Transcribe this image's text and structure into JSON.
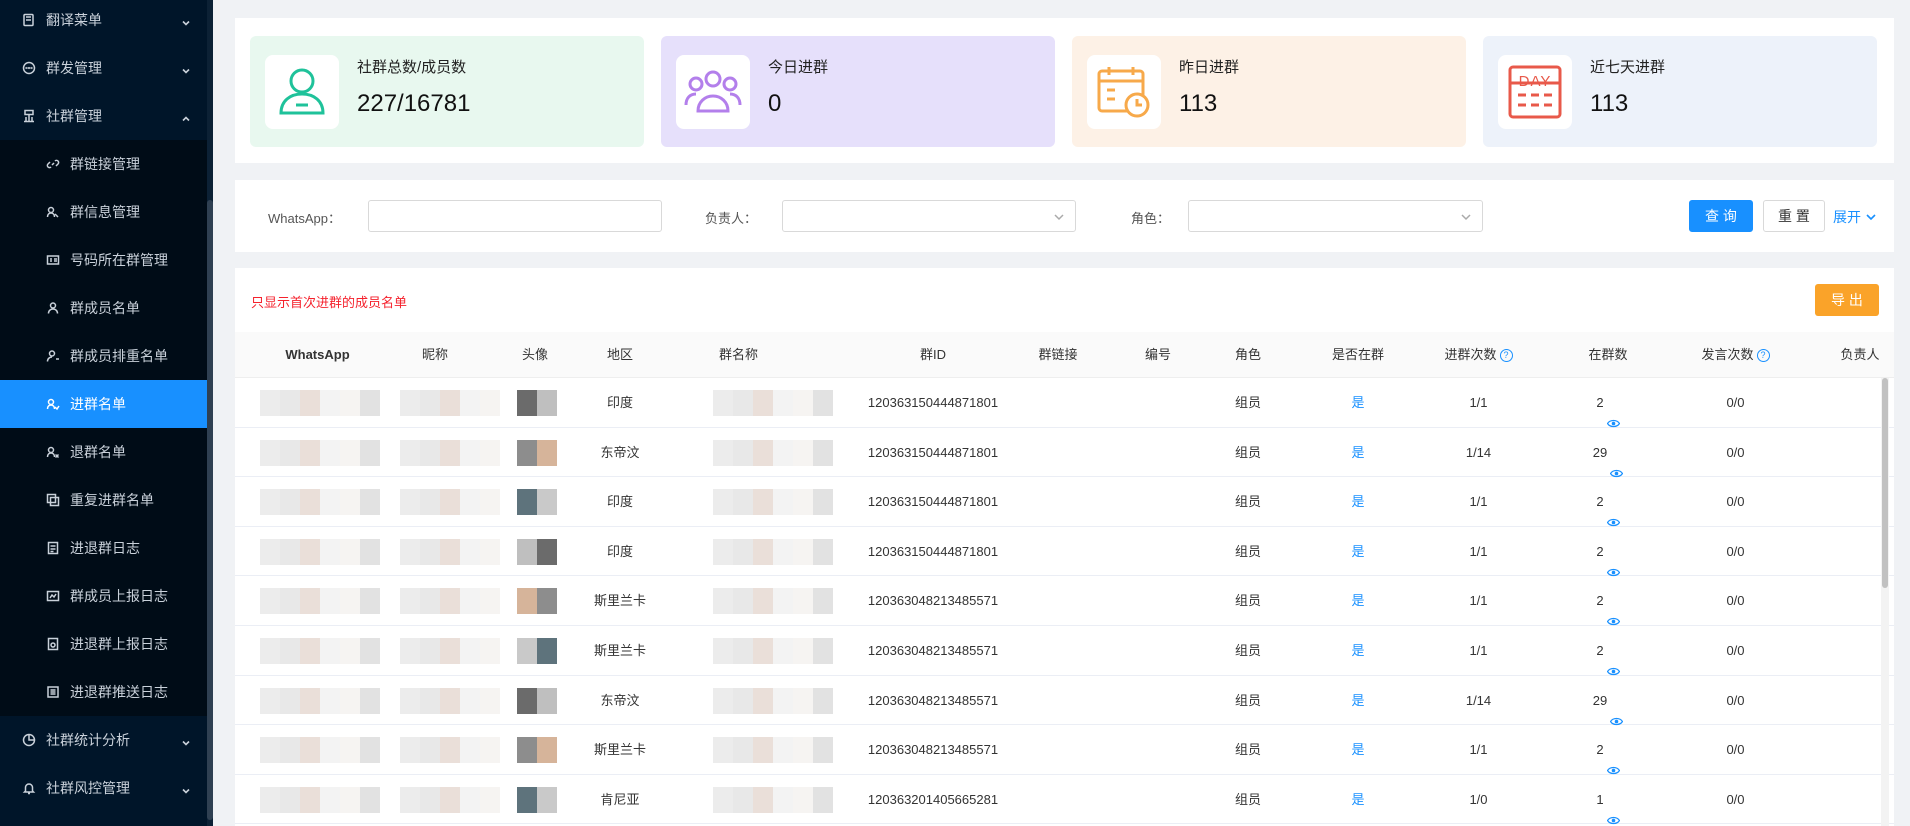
{
  "sidebar": {
    "items": [
      {
        "label": "翻译菜单",
        "level": "top",
        "icon": "translate-icon",
        "chevron": "down"
      },
      {
        "label": "群发管理",
        "level": "top",
        "icon": "chat-icon",
        "chevron": "down"
      },
      {
        "label": "社群管理",
        "level": "top",
        "icon": "community-icon",
        "chevron": "up"
      },
      {
        "label": "群链接管理",
        "level": "sub",
        "icon": "link-icon"
      },
      {
        "label": "群信息管理",
        "level": "sub",
        "icon": "group-info-icon"
      },
      {
        "label": "号码所在群管理",
        "level": "sub",
        "icon": "id-card-icon"
      },
      {
        "label": "群成员名单",
        "level": "sub",
        "icon": "user-icon"
      },
      {
        "label": "群成员排重名单",
        "level": "sub",
        "icon": "user-dedupe-icon"
      },
      {
        "label": "进群名单",
        "level": "sub",
        "icon": "join-group-icon",
        "active": true
      },
      {
        "label": "退群名单",
        "level": "sub",
        "icon": "leave-group-icon"
      },
      {
        "label": "重复进群名单",
        "level": "sub",
        "icon": "duplicate-icon"
      },
      {
        "label": "进退群日志",
        "level": "sub",
        "icon": "log-icon"
      },
      {
        "label": "群成员上报日志",
        "level": "sub",
        "icon": "report-icon"
      },
      {
        "label": "进退群上报日志",
        "level": "sub",
        "icon": "report-log-icon"
      },
      {
        "label": "进退群推送日志",
        "level": "sub",
        "icon": "push-log-icon"
      },
      {
        "label": "社群统计分析",
        "level": "top",
        "icon": "stats-icon",
        "chevron": "down"
      },
      {
        "label": "社群风控管理",
        "level": "top",
        "icon": "bell-icon",
        "chevron": "down"
      }
    ]
  },
  "stats": [
    {
      "label": "社群总数/成员数",
      "value": "227/16781",
      "bg": "#e8f8ef",
      "color": "#1fc29a",
      "icon": "user-icon"
    },
    {
      "label": "今日进群",
      "value": "0",
      "bg": "#e6e0fb",
      "color": "#b37feb",
      "icon": "group-icon"
    },
    {
      "label": "昨日进群",
      "value": "113",
      "bg": "#fdf1e6",
      "color": "#f7a94a",
      "icon": "calendar-clock-icon"
    },
    {
      "label": "近七天进群",
      "value": "113",
      "bg": "#edf2fa",
      "color": "#e8594a",
      "icon": "day-calendar-icon",
      "icon_text": "DAY"
    }
  ],
  "filter": {
    "whatsapp_label": "WhatsApp：",
    "whatsapp_value": "",
    "owner_label": "负责人：",
    "role_label": "角色：",
    "search_label": "查 询",
    "reset_label": "重 置",
    "expand_label": "展开"
  },
  "table": {
    "note": "只显示首次进群的成员名单",
    "export_label": "导 出",
    "columns": [
      "WhatsApp",
      "昵称",
      "头像",
      "地区",
      "群名称",
      "群ID",
      "群链接",
      "编号",
      "角色",
      "是否在群",
      "进群次数",
      "在群数",
      "发言次数",
      "负责人"
    ],
    "rows": [
      {
        "region": "印度",
        "group_id": "120363150444871801",
        "role": "组员",
        "in_group": "是",
        "joins": "1/1",
        "groups": "2",
        "messages": "0/0"
      },
      {
        "region": "东帝汶",
        "group_id": "120363150444871801",
        "role": "组员",
        "in_group": "是",
        "joins": "1/14",
        "groups": "29",
        "messages": "0/0"
      },
      {
        "region": "印度",
        "group_id": "120363150444871801",
        "role": "组员",
        "in_group": "是",
        "joins": "1/1",
        "groups": "2",
        "messages": "0/0"
      },
      {
        "region": "印度",
        "group_id": "120363150444871801",
        "role": "组员",
        "in_group": "是",
        "joins": "1/1",
        "groups": "2",
        "messages": "0/0"
      },
      {
        "region": "斯里兰卡",
        "group_id": "120363048213485571",
        "role": "组员",
        "in_group": "是",
        "joins": "1/1",
        "groups": "2",
        "messages": "0/0"
      },
      {
        "region": "斯里兰卡",
        "group_id": "120363048213485571",
        "role": "组员",
        "in_group": "是",
        "joins": "1/1",
        "groups": "2",
        "messages": "0/0"
      },
      {
        "region": "东帝汶",
        "group_id": "120363048213485571",
        "role": "组员",
        "in_group": "是",
        "joins": "1/14",
        "groups": "29",
        "messages": "0/0"
      },
      {
        "region": "斯里兰卡",
        "group_id": "120363048213485571",
        "role": "组员",
        "in_group": "是",
        "joins": "1/1",
        "groups": "2",
        "messages": "0/0"
      },
      {
        "region": "肯尼亚",
        "group_id": "120363201405665281",
        "role": "组员",
        "in_group": "是",
        "joins": "1/0",
        "groups": "1",
        "messages": "0/0"
      }
    ]
  },
  "colors": {
    "accent": "#1890ff",
    "sidebar_bg": "#001529",
    "export": "#faa329",
    "note": "#f5222d"
  }
}
